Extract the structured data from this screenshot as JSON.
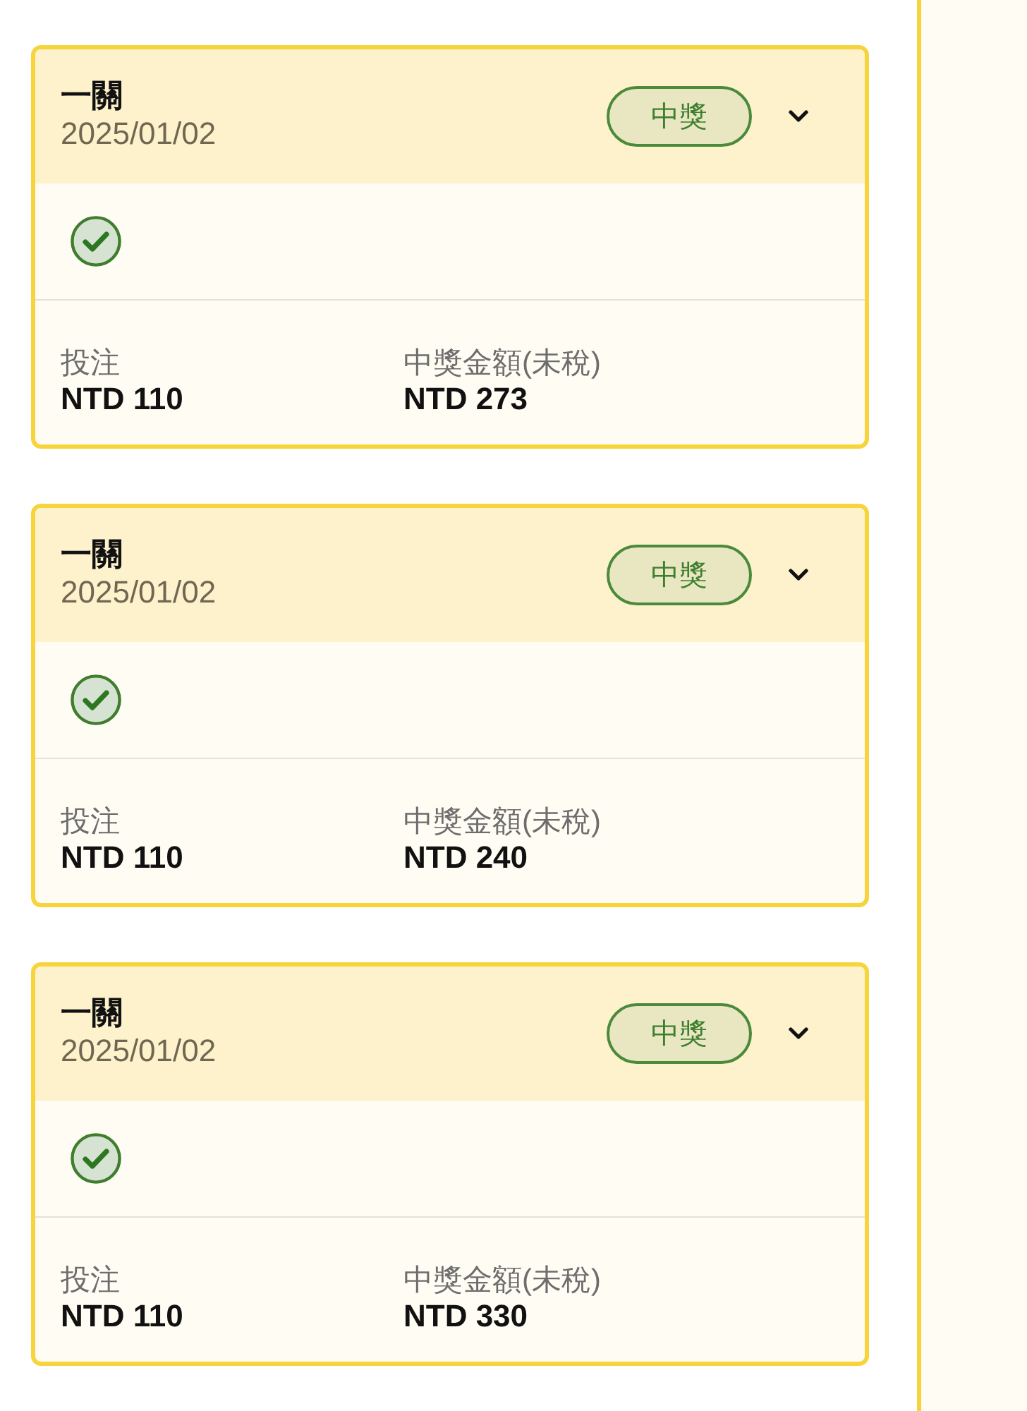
{
  "cards": [
    {
      "title": "一關",
      "date": "2025/01/02",
      "badge": "中獎",
      "expanded": false,
      "bet_label": "投注",
      "bet": "NTD 110",
      "payout_label": "中獎金額(未稅)",
      "payout": "NTD 273"
    },
    {
      "title": "一關",
      "date": "2025/01/02",
      "badge": "中獎",
      "expanded": false,
      "bet_label": "投注",
      "bet": "NTD 110",
      "payout_label": "中獎金額(未稅)",
      "payout": "NTD 240"
    },
    {
      "title": "一關",
      "date": "2025/01/02",
      "badge": "中獎",
      "expanded": false,
      "bet_label": "投注",
      "bet": "NTD 110",
      "payout_label": "中獎金額(未稅)",
      "payout": "NTD 330"
    }
  ]
}
